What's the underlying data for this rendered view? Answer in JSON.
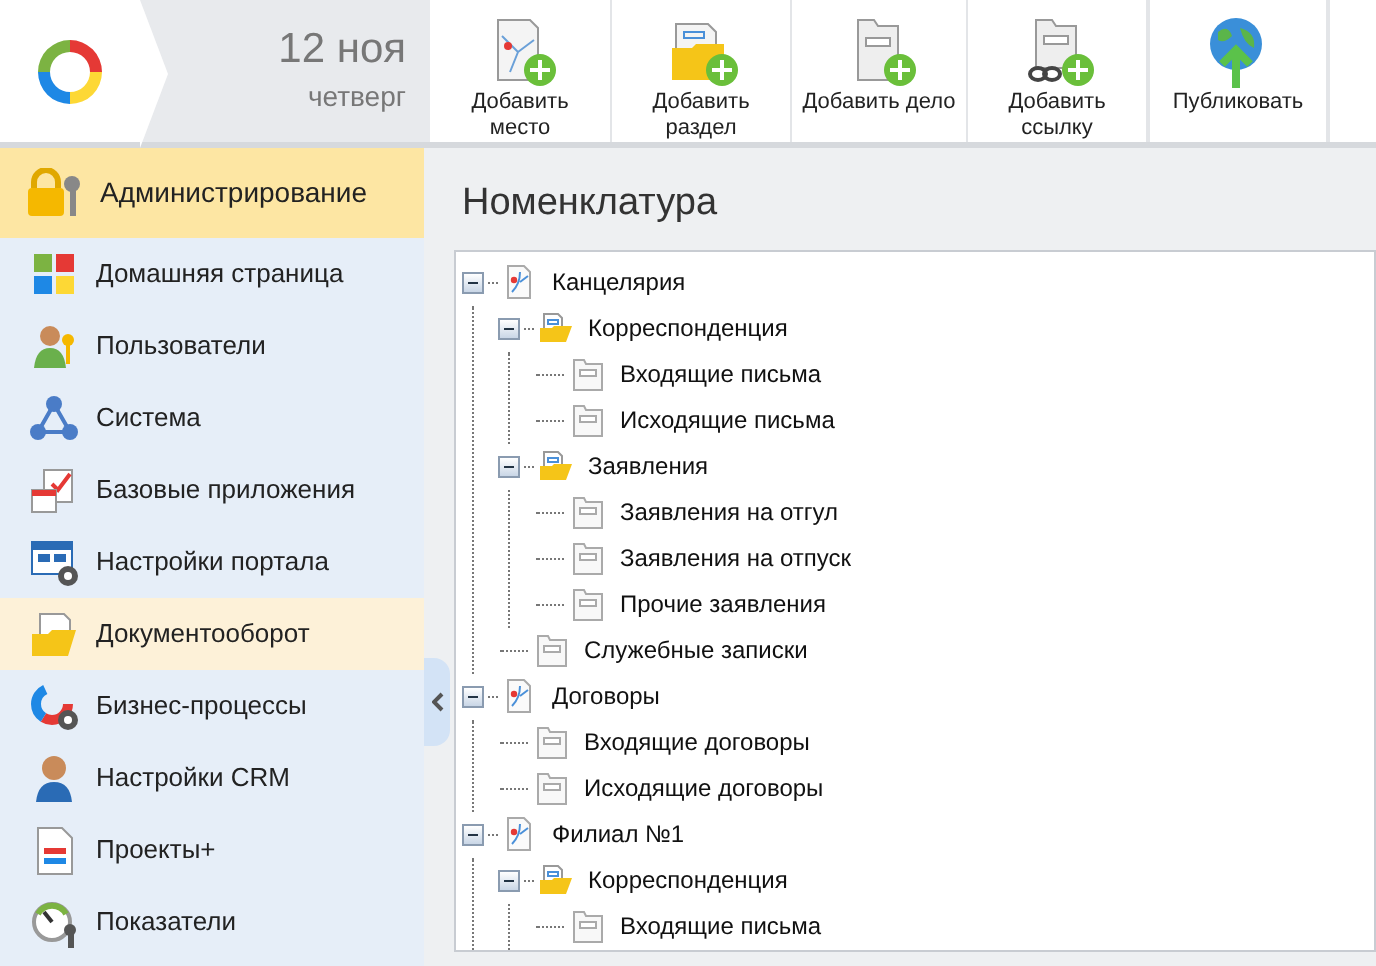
{
  "date": {
    "day": "12 ноя",
    "weekday": "четверг"
  },
  "toolbar": [
    {
      "label": "Добавить\nместо",
      "kind": "place"
    },
    {
      "label": "Добавить\nраздел",
      "kind": "section"
    },
    {
      "label": "Добавить дело",
      "kind": "case"
    },
    {
      "label": "Добавить\nссылку",
      "kind": "link"
    },
    {
      "label": "Публиковать",
      "kind": "publish"
    }
  ],
  "sidebar": {
    "header": "Администрирование",
    "items": [
      {
        "label": "Домашняя страница",
        "selected": false
      },
      {
        "label": "Пользователи",
        "selected": false
      },
      {
        "label": "Система",
        "selected": false
      },
      {
        "label": "Базовые приложения",
        "selected": false
      },
      {
        "label": "Настройки портала",
        "selected": false
      },
      {
        "label": "Документооборот",
        "selected": true
      },
      {
        "label": "Бизнес-процессы",
        "selected": false
      },
      {
        "label": "Настройки CRM",
        "selected": false
      },
      {
        "label": "Проекты+",
        "selected": false
      },
      {
        "label": "Показатели",
        "selected": false
      }
    ]
  },
  "title": "Номенклатура",
  "tree": [
    {
      "label": "Канцелярия",
      "kind": "place",
      "expanded": true,
      "children": [
        {
          "label": "Корреспонденция",
          "kind": "section",
          "expanded": true,
          "children": [
            {
              "label": "Входящие письма",
              "kind": "case"
            },
            {
              "label": "Исходящие письма",
              "kind": "case"
            }
          ]
        },
        {
          "label": "Заявления",
          "kind": "section",
          "expanded": true,
          "children": [
            {
              "label": "Заявления на отгул",
              "kind": "case"
            },
            {
              "label": "Заявления на отпуск",
              "kind": "case"
            },
            {
              "label": "Прочие заявления",
              "kind": "case"
            }
          ]
        },
        {
          "label": "Служебные записки",
          "kind": "case"
        }
      ]
    },
    {
      "label": "Договоры",
      "kind": "place",
      "expanded": true,
      "children": [
        {
          "label": "Входящие договоры",
          "kind": "case"
        },
        {
          "label": "Исходящие договоры",
          "kind": "case"
        }
      ]
    },
    {
      "label": "Филиал №1",
      "kind": "place",
      "expanded": true,
      "children": [
        {
          "label": "Корреспонденция",
          "kind": "section",
          "expanded": true,
          "children": [
            {
              "label": "Входящие письма",
              "kind": "case"
            }
          ]
        }
      ]
    }
  ]
}
